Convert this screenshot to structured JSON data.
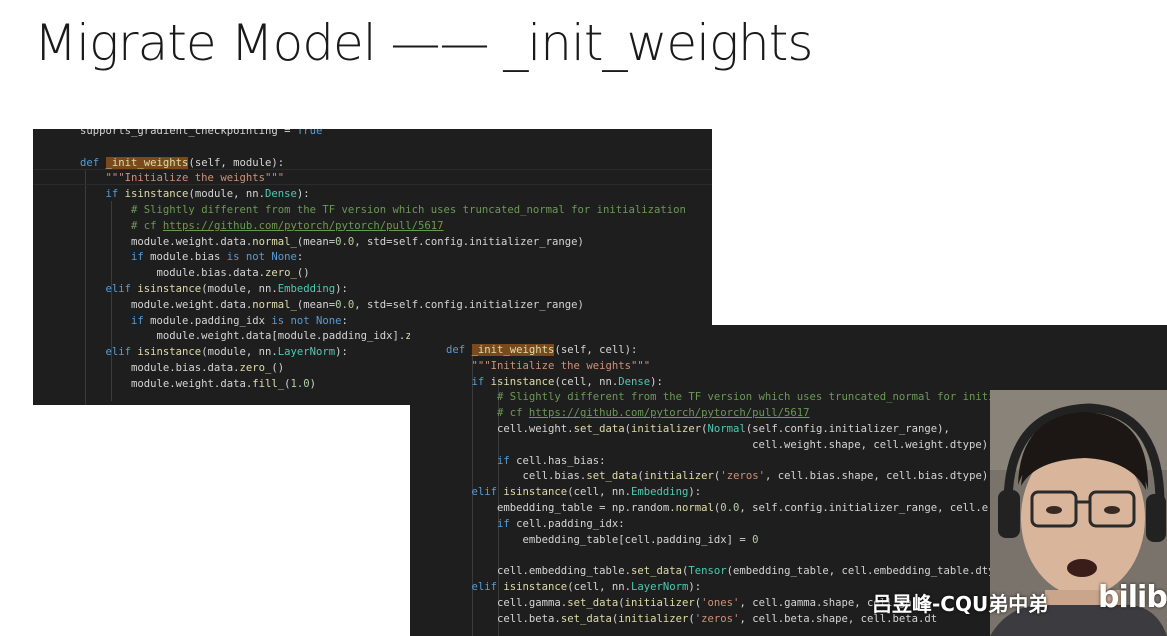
{
  "slide": {
    "title": "Migrate Model —— _init_weights"
  },
  "pytorch_code": {
    "lines": [
      [
        [
          "k-kw",
          ""
        ],
        [
          "",
          "supports_gradient_checkpointing = "
        ],
        [
          "k-kw",
          "True"
        ]
      ],
      [],
      [
        [
          "k-kw",
          "def "
        ],
        [
          "k-hl",
          "_init_weights"
        ],
        [
          "",
          "(self, module):"
        ]
      ],
      [
        [
          "k-str",
          "    \"\"\"Initialize the weights\"\"\""
        ]
      ],
      [
        [
          "",
          "    "
        ],
        [
          "k-kw",
          "if "
        ],
        [
          "k-fn",
          "isinstance"
        ],
        [
          "",
          "(module, nn."
        ],
        [
          "k-cls",
          "Dense"
        ],
        [
          "",
          "):"
        ]
      ],
      [
        [
          "",
          "        "
        ],
        [
          "k-cm",
          "# Slightly different from the TF version which uses truncated_normal for initialization"
        ]
      ],
      [
        [
          "",
          "        "
        ],
        [
          "k-cm",
          "# cf "
        ],
        [
          "k-link",
          "https://github.com/pytorch/pytorch/pull/5617"
        ]
      ],
      [
        [
          "",
          "        module.weight.data."
        ],
        [
          "k-fn",
          "normal_"
        ],
        [
          "",
          "(mean="
        ],
        [
          "k-num",
          "0.0"
        ],
        [
          "",
          ", std=self.config.initializer_range)"
        ]
      ],
      [
        [
          "",
          "        "
        ],
        [
          "k-kw",
          "if "
        ],
        [
          "",
          "module.bias "
        ],
        [
          "k-kw",
          "is not None"
        ],
        [
          "",
          ":"
        ]
      ],
      [
        [
          "",
          "            module.bias.data."
        ],
        [
          "k-fn",
          "zero_"
        ],
        [
          "",
          "()"
        ]
      ],
      [
        [
          "",
          "    "
        ],
        [
          "k-kw",
          "elif "
        ],
        [
          "k-fn",
          "isinstance"
        ],
        [
          "",
          "(module, nn."
        ],
        [
          "k-cls",
          "Embedding"
        ],
        [
          "",
          "):"
        ]
      ],
      [
        [
          "",
          "        module.weight.data."
        ],
        [
          "k-fn",
          "normal_"
        ],
        [
          "",
          "(mean="
        ],
        [
          "k-num",
          "0.0"
        ],
        [
          "",
          ", std=self.config.initializer_range)"
        ]
      ],
      [
        [
          "",
          "        "
        ],
        [
          "k-kw",
          "if "
        ],
        [
          "",
          "module.padding_idx "
        ],
        [
          "k-kw",
          "is not None"
        ],
        [
          "",
          ":"
        ]
      ],
      [
        [
          "",
          "            module.weight.data[module.padding_idx]."
        ],
        [
          "k-fn",
          "z"
        ]
      ],
      [
        [
          "",
          "    "
        ],
        [
          "k-kw",
          "elif "
        ],
        [
          "k-fn",
          "isinstance"
        ],
        [
          "",
          "(module, nn."
        ],
        [
          "k-cls",
          "LayerNorm"
        ],
        [
          "",
          "):"
        ]
      ],
      [
        [
          "",
          "        module.bias.data."
        ],
        [
          "k-fn",
          "zero_"
        ],
        [
          "",
          "()"
        ]
      ],
      [
        [
          "",
          "        module.weight.data."
        ],
        [
          "k-fn",
          "fill_"
        ],
        [
          "",
          "("
        ],
        [
          "k-num",
          "1.0"
        ],
        [
          "",
          ")"
        ]
      ]
    ]
  },
  "mindspore_code": {
    "lines": [
      [
        [
          "k-kw",
          "def "
        ],
        [
          "k-hl",
          "_init_weights"
        ],
        [
          "",
          "(self, cell):"
        ]
      ],
      [
        [
          "k-str",
          "    \"\"\"Initialize the weights\"\"\""
        ]
      ],
      [
        [
          "",
          "    "
        ],
        [
          "k-kw",
          "if "
        ],
        [
          "k-fn",
          "isinstance"
        ],
        [
          "",
          "(cell, nn."
        ],
        [
          "k-cls",
          "Dense"
        ],
        [
          "",
          "):"
        ]
      ],
      [
        [
          "",
          "        "
        ],
        [
          "k-cm",
          "# Slightly different from the TF version which uses truncated_normal for initialization"
        ]
      ],
      [
        [
          "",
          "        "
        ],
        [
          "k-cm",
          "# cf "
        ],
        [
          "k-link",
          "https://github.com/pytorch/pytorch/pull/5617"
        ]
      ],
      [
        [
          "",
          "        cell.weight."
        ],
        [
          "k-fn",
          "set_data"
        ],
        [
          "",
          "("
        ],
        [
          "k-fn",
          "initializer"
        ],
        [
          "",
          "("
        ],
        [
          "k-cls",
          "Normal"
        ],
        [
          "",
          "(self.config.initializer_range),"
        ]
      ],
      [
        [
          "",
          "                                                cell.weight.shape, cell.weight.dtype))"
        ]
      ],
      [
        [
          "",
          "        "
        ],
        [
          "k-kw",
          "if "
        ],
        [
          "",
          "cell.has_bias:"
        ]
      ],
      [
        [
          "",
          "            cell.bias."
        ],
        [
          "k-fn",
          "set_data"
        ],
        [
          "",
          "("
        ],
        [
          "k-fn",
          "initializer"
        ],
        [
          "",
          "("
        ],
        [
          "k-str",
          "'zeros'"
        ],
        [
          "",
          ", cell.bias.shape, cell.bias.dtype))"
        ]
      ],
      [
        [
          "",
          "    "
        ],
        [
          "k-kw",
          "elif "
        ],
        [
          "k-fn",
          "isinstance"
        ],
        [
          "",
          "(cell, nn."
        ],
        [
          "k-cls",
          "Embedding"
        ],
        [
          "",
          "):"
        ]
      ],
      [
        [
          "",
          "        embedding_table = np.random."
        ],
        [
          "k-fn",
          "normal"
        ],
        [
          "",
          "("
        ],
        [
          "k-num",
          "0.0"
        ],
        [
          "",
          ", self.config.initializer_range, cell.e"
        ]
      ],
      [
        [
          "",
          "        "
        ],
        [
          "k-kw",
          "if "
        ],
        [
          "",
          "cell.padding_idx:"
        ]
      ],
      [
        [
          "",
          "            embedding_table[cell.padding_idx] = "
        ],
        [
          "k-num",
          "0"
        ]
      ],
      [],
      [
        [
          "",
          "        cell.embedding_table."
        ],
        [
          "k-fn",
          "set_data"
        ],
        [
          "",
          "("
        ],
        [
          "k-cls",
          "Tensor"
        ],
        [
          "",
          "(embedding_table, cell.embedding_table.dty"
        ]
      ],
      [
        [
          "",
          "    "
        ],
        [
          "k-kw",
          "elif "
        ],
        [
          "k-fn",
          "isinstance"
        ],
        [
          "",
          "(cell, nn."
        ],
        [
          "k-cls",
          "LayerNorm"
        ],
        [
          "",
          "):"
        ]
      ],
      [
        [
          "",
          "        cell.gamma."
        ],
        [
          "k-fn",
          "set_data"
        ],
        [
          "",
          "("
        ],
        [
          "k-fn",
          "initializer"
        ],
        [
          "",
          "("
        ],
        [
          "k-str",
          "'ones'"
        ],
        [
          "",
          ", cell.gamma.shape, cell.ga"
        ]
      ],
      [
        [
          "",
          "        cell.beta."
        ],
        [
          "k-fn",
          "set_data"
        ],
        [
          "",
          "("
        ],
        [
          "k-fn",
          "initializer"
        ],
        [
          "",
          "("
        ],
        [
          "k-str",
          "'zeros'"
        ],
        [
          "",
          ", cell.beta.shape, cell.beta.dt"
        ]
      ]
    ]
  },
  "overlay": {
    "watermark": "吕昱峰-CQU弟中弟",
    "logo": "bilib"
  }
}
